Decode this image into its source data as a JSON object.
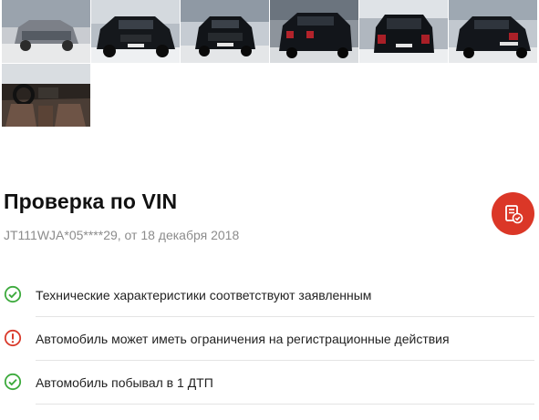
{
  "gallery": {
    "photos": [
      {
        "icon": "car-front-photo"
      },
      {
        "icon": "car-front-photo"
      },
      {
        "icon": "car-front-photo"
      },
      {
        "icon": "car-rear-photo"
      },
      {
        "icon": "car-rear-photo"
      },
      {
        "icon": "car-rear-photo"
      },
      {
        "icon": "car-interior-photo"
      }
    ]
  },
  "vin_check": {
    "title": "Проверка по VIN",
    "subtitle": "JT111WJA*05****29, от 18 декабря 2018",
    "report_icon": "report-check-icon",
    "items": [
      {
        "status": "ok",
        "icon": "check-circle-icon",
        "text": "Технические характеристики соответствуют заявленным"
      },
      {
        "status": "warning",
        "icon": "warning-circle-icon",
        "text": "Автомобиль может иметь ограничения на регистрационные действия"
      },
      {
        "status": "ok",
        "icon": "check-circle-icon",
        "text": "Автомобиль побывал в 1 ДТП"
      }
    ]
  },
  "colors": {
    "ok": "#3daa3d",
    "warning": "#d93a2b",
    "accent": "#db3727"
  }
}
